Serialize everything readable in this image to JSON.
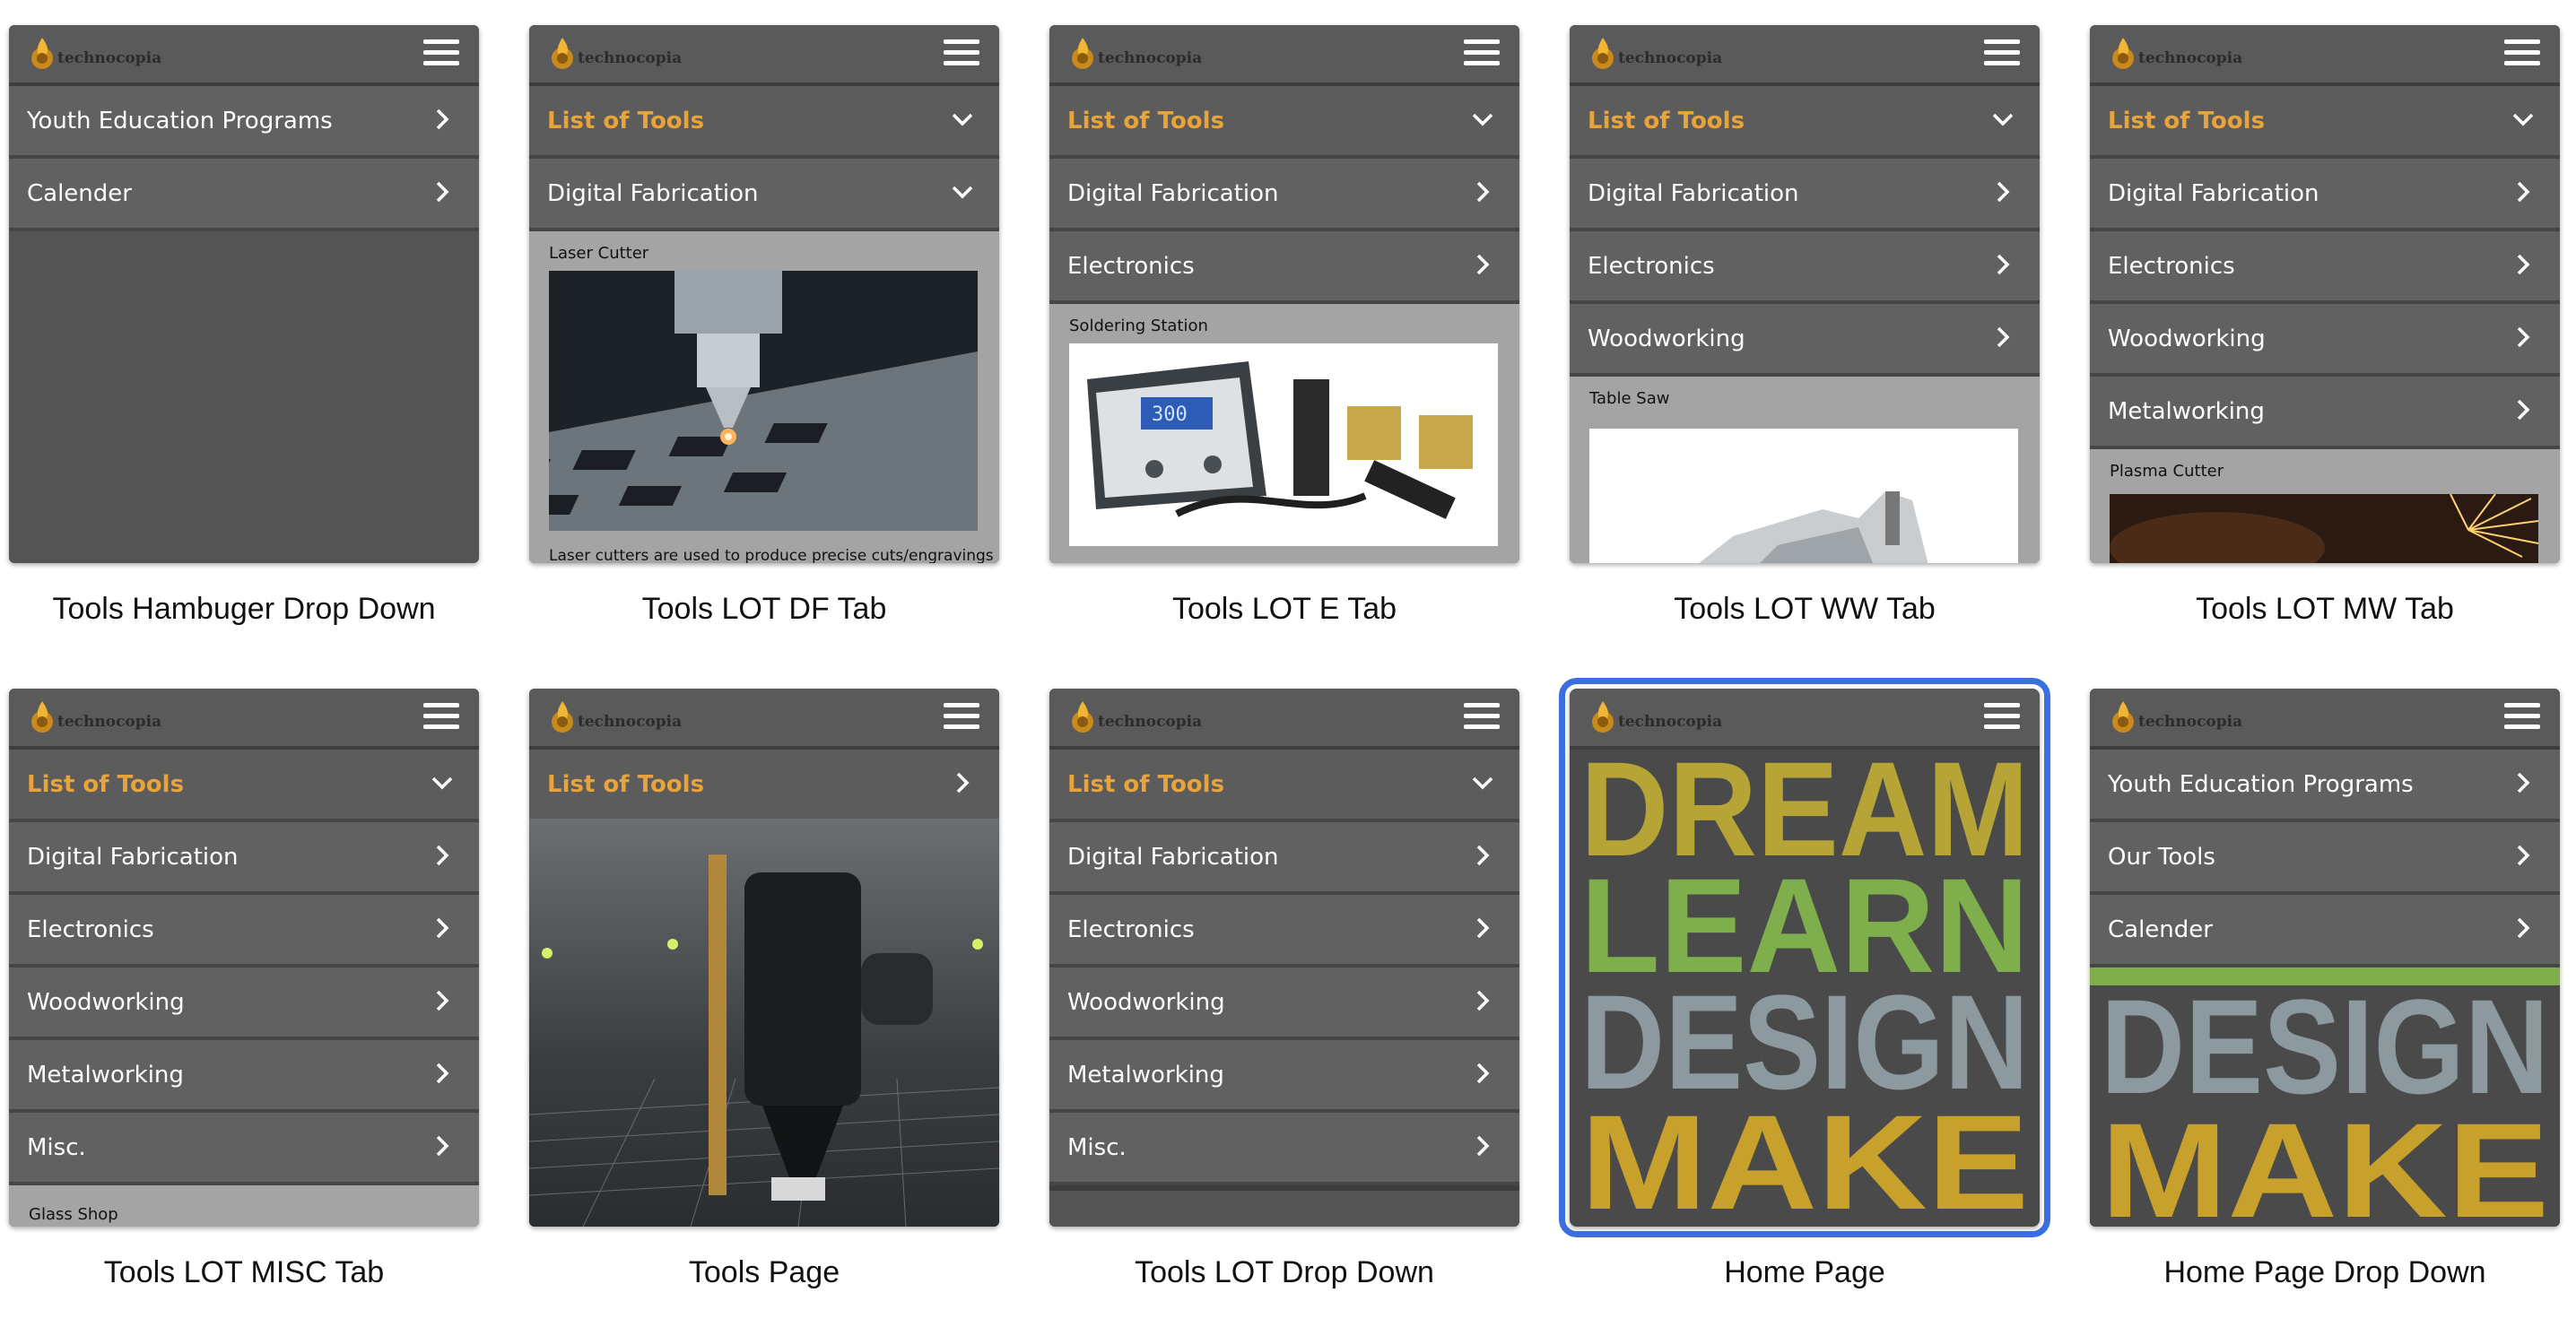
{
  "app": {
    "logo_text": "technocopia"
  },
  "nav_labels": {
    "list_of_tools": "List of Tools",
    "digital_fabrication": "Digital Fabrication",
    "electronics": "Electronics",
    "woodworking": "Woodworking",
    "metalworking": "Metalworking",
    "misc": "Misc.",
    "youth_education": "Youth Education Programs",
    "our_tools": "Our Tools",
    "calender": "Calender"
  },
  "tool_panels": {
    "laser_cutter": "Laser Cutter",
    "laser_caption": "Laser cutters are used to produce precise cuts/engravings",
    "soldering_station": "Soldering Station",
    "table_saw": "Table Saw",
    "plasma_cutter": "Plasma Cutter",
    "glass_shop": "Glass Shop"
  },
  "home_words": [
    "DREAM",
    "LEARN",
    "DESIGN",
    "MAKE"
  ],
  "soldering_display": "300",
  "screens": [
    {
      "caption": "Tools Hambuger Drop Down"
    },
    {
      "caption": "Tools LOT DF Tab"
    },
    {
      "caption": "Tools LOT E Tab"
    },
    {
      "caption": "Tools LOT WW Tab"
    },
    {
      "caption": "Tools LOT MW Tab"
    },
    {
      "caption": "Tools LOT MISC Tab"
    },
    {
      "caption": "Tools Page"
    },
    {
      "caption": "Tools LOT Drop Down"
    },
    {
      "caption": "Home Page",
      "selected": true
    },
    {
      "caption": "Home Page Drop Down"
    }
  ],
  "colors": {
    "accent_orange": "#e8a33a",
    "selection_blue": "#3b6fe0",
    "bar_gray": "#5a5a5a"
  }
}
